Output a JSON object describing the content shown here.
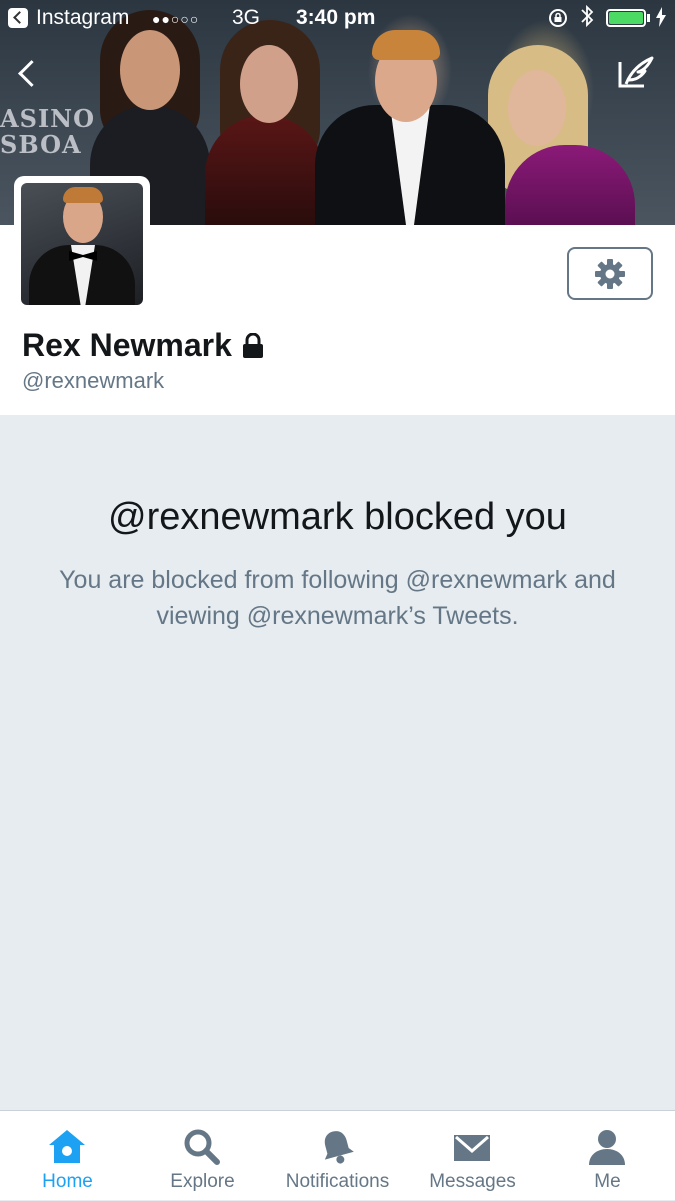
{
  "status_bar": {
    "back_app": "Instagram",
    "signal": "●●○○○",
    "network": "3G",
    "time": "3:40 pm"
  },
  "banner": {
    "sign_text_1": "ASINO",
    "sign_text_2": "SBOA"
  },
  "profile": {
    "name": "Rex Newmark",
    "handle": "@rexnewmark",
    "protected": true
  },
  "blocked": {
    "title": "@rexnewmark blocked you",
    "text": "You are blocked from following @rexnewmark and viewing @rexnewmark’s Tweets."
  },
  "tabs": [
    {
      "label": "Home",
      "icon": "home-icon",
      "active": true
    },
    {
      "label": "Explore",
      "icon": "search-icon",
      "active": false
    },
    {
      "label": "Notifications",
      "icon": "bell-icon",
      "active": false
    },
    {
      "label": "Messages",
      "icon": "envelope-icon",
      "active": false
    },
    {
      "label": "Me",
      "icon": "person-icon",
      "active": false
    }
  ],
  "colors": {
    "accent": "#1da1f2",
    "secondary_text": "#657786",
    "background": "#e6ecf0",
    "battery": "#4cd964"
  }
}
